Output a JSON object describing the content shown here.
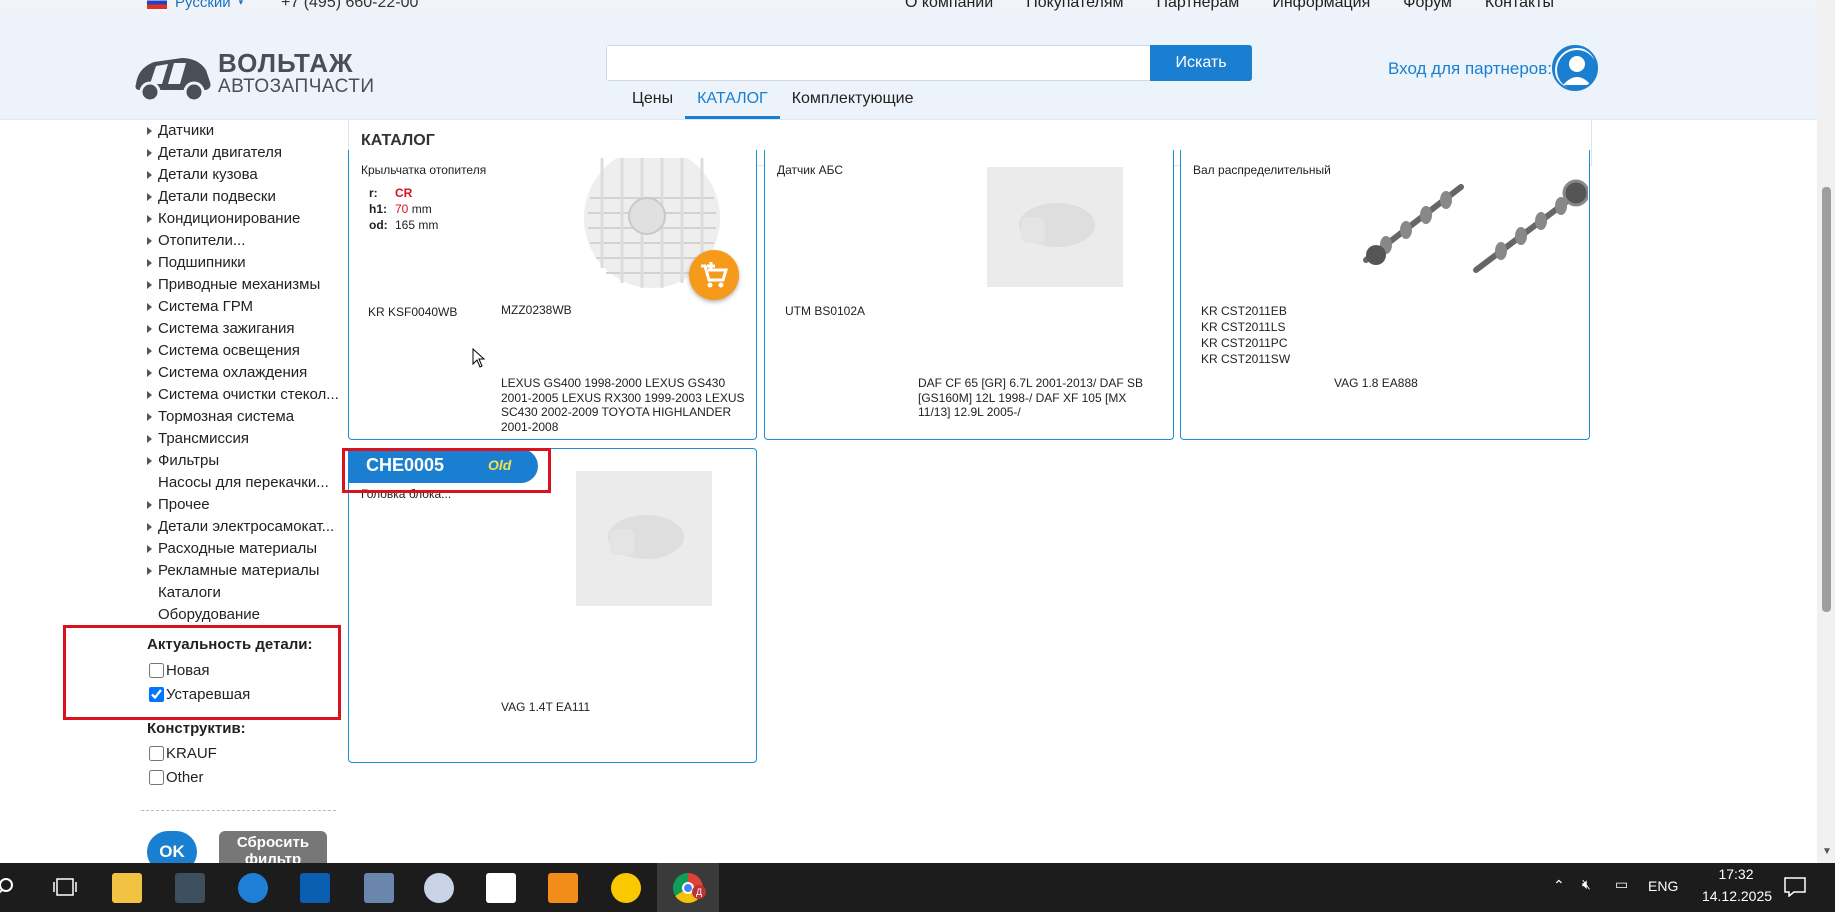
{
  "topbar": {
    "language": "Русский",
    "phone": "+7 (495) 660-22-00",
    "menu": [
      "О компании",
      "Покупателям",
      "Партнерам",
      "Информация",
      "Форум",
      "Контакты"
    ]
  },
  "header": {
    "logo_line1": "ВОЛЬТАЖ",
    "logo_line2": "АВТОЗАПЧАСТИ",
    "search_value": "",
    "search_button": "Искать",
    "tabs": [
      "Цены",
      "КАТАЛОГ",
      "Комплектующие"
    ],
    "active_tab": "КАТАЛОГ",
    "partner_login": "Вход для партнеров:"
  },
  "sidebar": {
    "categories": [
      {
        "label": "Датчики",
        "arrow": true
      },
      {
        "label": "Детали двигателя",
        "arrow": true
      },
      {
        "label": "Детали кузова",
        "arrow": true
      },
      {
        "label": "Детали подвески",
        "arrow": true
      },
      {
        "label": "Кондиционирование",
        "arrow": true
      },
      {
        "label": "Отопители...",
        "arrow": true
      },
      {
        "label": "Подшипники",
        "arrow": true
      },
      {
        "label": "Приводные механизмы",
        "arrow": true
      },
      {
        "label": "Система ГРМ",
        "arrow": true
      },
      {
        "label": "Система зажигания",
        "arrow": true
      },
      {
        "label": "Система освещения",
        "arrow": true
      },
      {
        "label": "Система охлаждения",
        "arrow": true
      },
      {
        "label": "Система очистки стекол...",
        "arrow": true
      },
      {
        "label": "Тормозная система",
        "arrow": true
      },
      {
        "label": "Трансмиссия",
        "arrow": true
      },
      {
        "label": "Фильтры",
        "arrow": true
      },
      {
        "label": "Насосы для перекачки...",
        "arrow": false
      },
      {
        "label": "Прочее",
        "arrow": true
      },
      {
        "label": "Детали электросамокат...",
        "arrow": true
      },
      {
        "label": "Расходные материалы",
        "arrow": true
      },
      {
        "label": "Рекламные материалы",
        "arrow": true
      },
      {
        "label": "Каталоги",
        "arrow": false
      },
      {
        "label": "Оборудование",
        "arrow": false
      }
    ],
    "filter_actuality": {
      "title": "Актуальность детали:",
      "options": [
        {
          "label": "Новая",
          "checked": false
        },
        {
          "label": "Устаревшая",
          "checked": true
        }
      ]
    },
    "filter_construct": {
      "title": "Конструктив:",
      "options": [
        {
          "label": "KRAUF",
          "checked": false
        },
        {
          "label": "Other",
          "checked": false
        }
      ]
    },
    "ok_button": "OK",
    "reset_button": "Сбросить фильтр"
  },
  "catalog": {
    "title": "КАТАЛОГ",
    "cards": [
      {
        "name": "Крыльчатка отопителя",
        "props": [
          {
            "key": "r:",
            "value": "CR",
            "unit": ""
          },
          {
            "key": "h1:",
            "value": "70",
            "unit": "mm"
          },
          {
            "key": "od:",
            "value": "165 mm",
            "unit": ""
          }
        ],
        "codes": [
          "KR KSF0040WB"
        ],
        "oem": "MZZ0238WB",
        "applicability": "LEXUS GS400 1998-2000 LEXUS GS430 2001-2005 LEXUS RX300 1999-2003 LEXUS SC430 2002-2009 TOYOTA HIGHLANDER 2001-2008"
      },
      {
        "name": "Датчик АБС",
        "codes": [
          "UTM BS0102A"
        ],
        "applicability": "DAF CF 65 [GR] 6.7L 2001-2013/ DAF SB [GS160M] 12L 1998-/ DAF XF 105 [MX 11/13] 12.9L 2005-/"
      },
      {
        "name": "Вал распределительный",
        "codes": [
          "KR CST2011EB",
          "KR CST2011LS",
          "KR CST2011PC",
          "KR CST2011SW"
        ],
        "applicability": "VAG 1.8 EA888"
      },
      {
        "name": "Головка блока...",
        "badge_code": "CHE0005",
        "badge_status": "Old",
        "applicability": "VAG 1.4T EA111"
      }
    ]
  },
  "taskbar": {
    "language": "ENG",
    "time": "17:32",
    "date": "14.12.2025",
    "chrome_badge": "Д"
  },
  "colors": {
    "accent": "#1a7fd0",
    "highlight": "#d9121e",
    "cart": "#f59a1b"
  }
}
